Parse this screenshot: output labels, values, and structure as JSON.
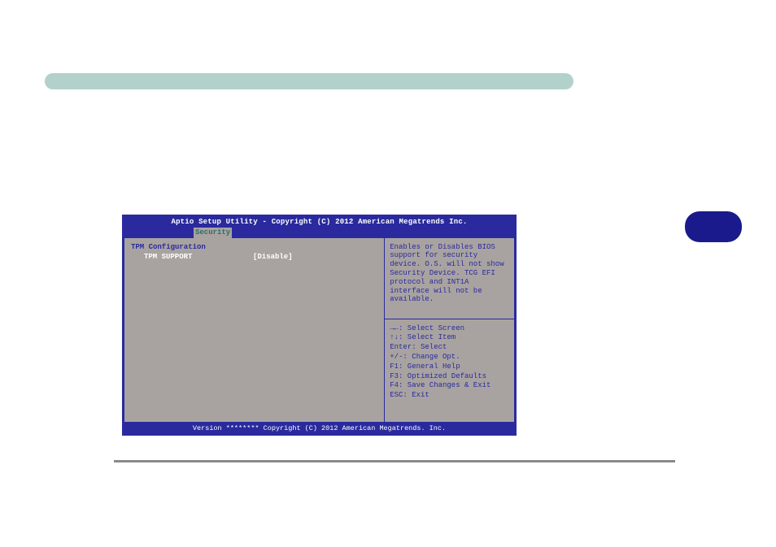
{
  "banner": {},
  "badge": {},
  "bios": {
    "title": "Aptio Setup Utility - Copyright (C) 2012 American Megatrends Inc.",
    "tab": "Security",
    "left": {
      "heading": "TPM Configuration",
      "item_label": "TPM SUPPORT",
      "item_value": "[Disable]"
    },
    "help": "Enables or Disables BIOS support for security device. O.S. will not show Security Device. TCG EFI protocol and INT1A interface will not be available.",
    "nav": {
      "select_screen": "Select Screen",
      "select_item": "Select Item",
      "enter": "Enter: Select",
      "change": "+/-: Change Opt.",
      "f1": "F1: General Help",
      "f3": "F3: Optimized Defaults",
      "f4": "F4: Save Changes & Exit",
      "esc": "ESC: Exit"
    },
    "footer": "Version ******** Copyright (C) 2012 American Megatrends. Inc."
  }
}
